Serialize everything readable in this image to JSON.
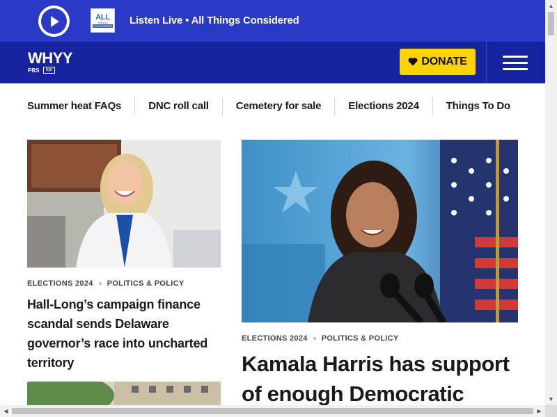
{
  "live_bar": {
    "text": "Listen Live • All Things Considered",
    "program_logo": {
      "line1": "ALL",
      "line2": "THINGS",
      "line3": "CONSIDERED"
    }
  },
  "header": {
    "logo_text": "WHYY",
    "logo_pbs": "PBS",
    "logo_npr": "npr",
    "donate_label": "DONATE"
  },
  "topics": [
    "Summer heat FAQs",
    "DNC roll call",
    "Cemetery for sale",
    "Elections 2024",
    "Things To Do"
  ],
  "stories": [
    {
      "tags": [
        "ELECTIONS 2024",
        "POLITICS & POLICY"
      ],
      "headline": "Hall-Long’s campaign finance scandal sends Delaware governor’s race into uncharted territory"
    },
    {
      "tags": [
        "ELECTIONS 2024",
        "POLITICS & POLICY"
      ],
      "headline": "Kamala Harris has support of enough Democratic"
    }
  ],
  "colors": {
    "live_bar": "#2a39c6",
    "header": "#15249e",
    "donate": "#ffd200",
    "text": "#1a1a1a"
  },
  "icons": {
    "play": "play-icon",
    "heart": "heart-icon",
    "menu": "hamburger-menu-icon"
  }
}
